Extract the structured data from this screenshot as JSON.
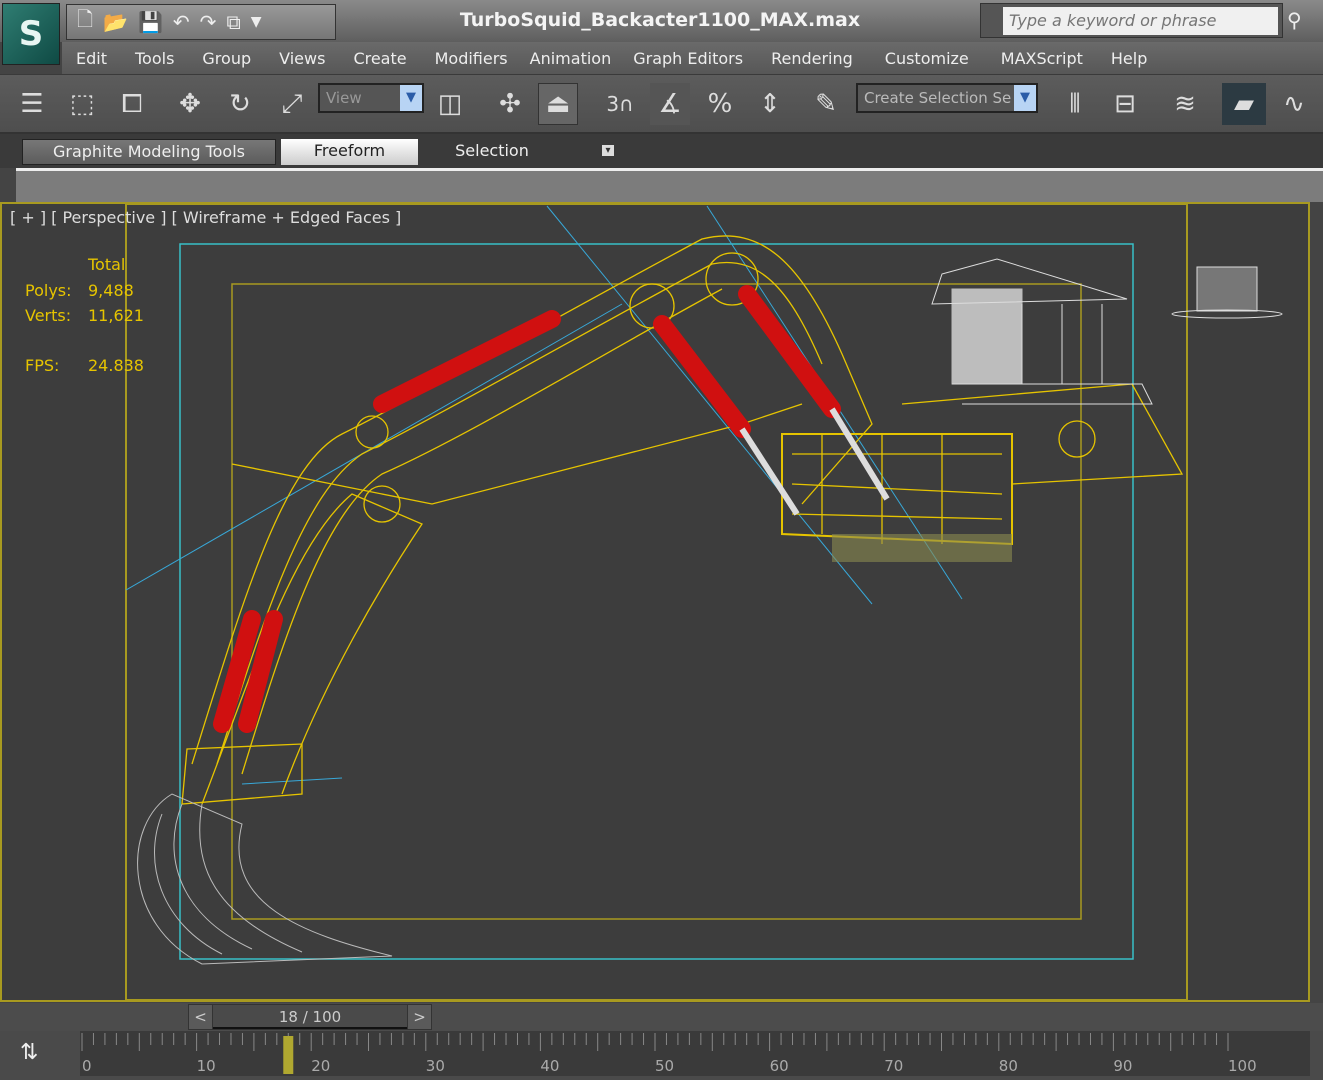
{
  "app": {
    "title": "TurboSquid_Backacter1100_MAX.max",
    "logo": "3ds Max"
  },
  "search": {
    "placeholder": "Type a keyword or phrase"
  },
  "menu": [
    "Edit",
    "Tools",
    "Group",
    "Views",
    "Create",
    "Modifiers",
    "Animation",
    "Graph Editors",
    "Rendering",
    "Customize",
    "MAXScript",
    "Help"
  ],
  "toolbar": {
    "ref_coord": "View",
    "selection_set": "Create Selection Se",
    "snap_label": "3"
  },
  "ribbon": {
    "tabs": [
      "Graphite Modeling Tools",
      "Freeform",
      "Selection"
    ],
    "active": "Freeform"
  },
  "viewport": {
    "label": "[ + ] [ Perspective ] [ Wireframe + Edged Faces ]",
    "stats": {
      "header": "Total",
      "polys_label": "Polys:",
      "polys": "9,488",
      "verts_label": "Verts:",
      "verts": "11,621",
      "fps_label": "FPS:",
      "fps": "24.838"
    }
  },
  "timeline": {
    "frame_display": "18 / 100",
    "prev": "<",
    "next": ">",
    "current_frame": 18,
    "total_frames": 100,
    "tick_labels": [
      "0",
      "10",
      "20",
      "30",
      "40",
      "50",
      "60",
      "70",
      "80",
      "90",
      "100"
    ]
  },
  "colors": {
    "wire": "#e6c400",
    "cyl": "#d01010",
    "safe_outer": "#a89a20",
    "safe_mid": "#38c0c8",
    "bg": "#3d3d3d"
  }
}
